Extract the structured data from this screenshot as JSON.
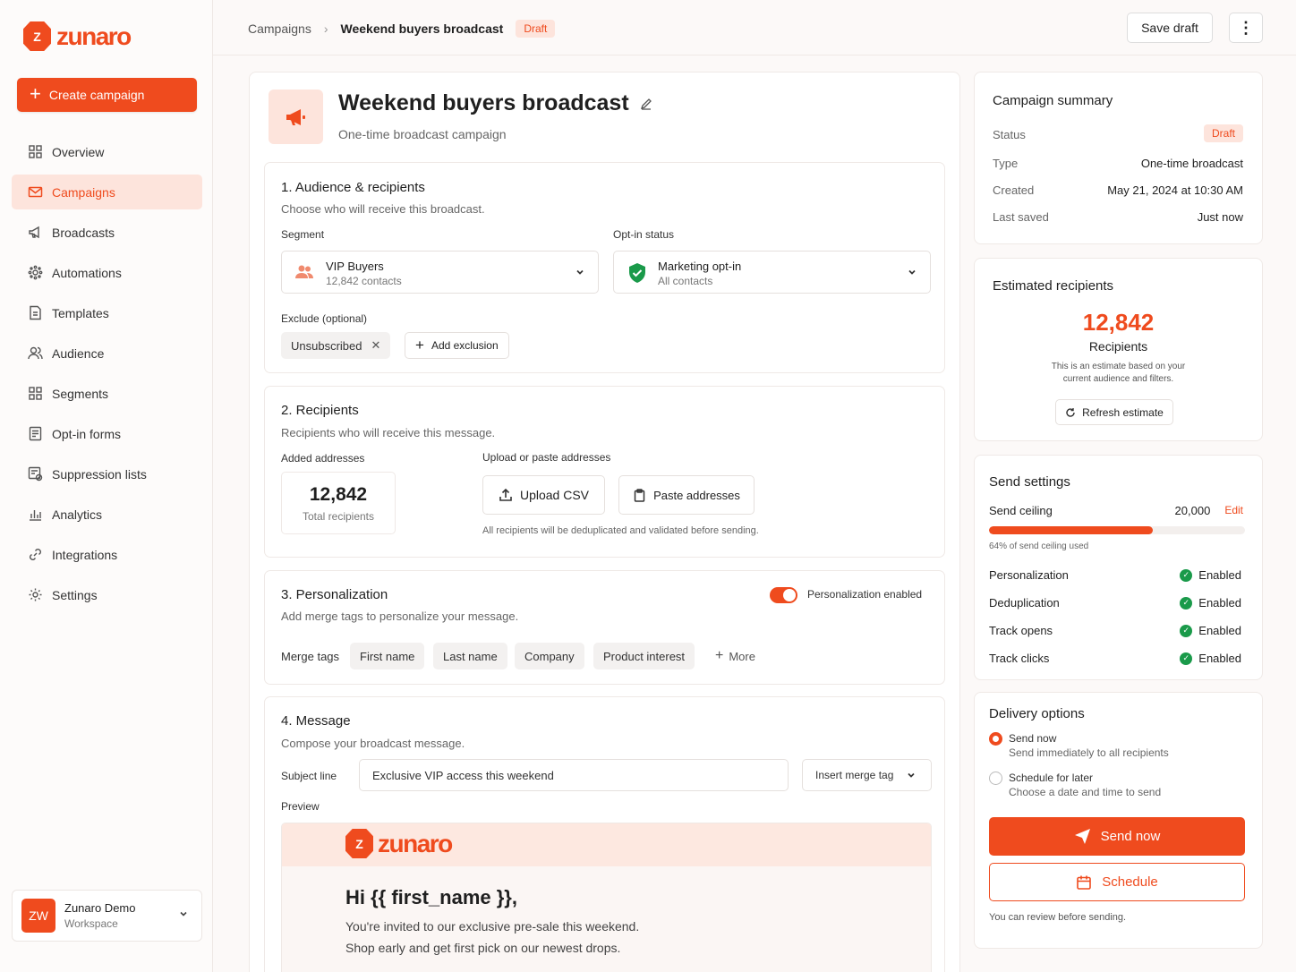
{
  "brand": {
    "name": "zunaro",
    "mark": "Z",
    "accent": "#ef4b1e"
  },
  "sidebar": {
    "create_label": "Create campaign",
    "items": [
      {
        "label": "Overview",
        "icon": "grid-icon"
      },
      {
        "label": "Campaigns",
        "icon": "mail-icon",
        "active": true
      },
      {
        "label": "Broadcasts",
        "icon": "megaphone-icon"
      },
      {
        "label": "Automations",
        "icon": "automation-icon"
      },
      {
        "label": "Templates",
        "icon": "template-icon"
      },
      {
        "label": "Audience",
        "icon": "users-icon"
      },
      {
        "label": "Segments",
        "icon": "segments-icon"
      },
      {
        "label": "Opt-in forms",
        "icon": "form-icon"
      },
      {
        "label": "Suppression lists",
        "icon": "suppression-icon"
      },
      {
        "label": "Analytics",
        "icon": "analytics-icon"
      },
      {
        "label": "Integrations",
        "icon": "link-icon"
      },
      {
        "label": "Settings",
        "icon": "gear-icon"
      }
    ],
    "workspace": {
      "initials": "ZW",
      "name": "Zunaro Demo",
      "sub": "Workspace"
    }
  },
  "topbar": {
    "crumb_root": "Campaigns",
    "crumb_current": "Weekend buyers broadcast",
    "status_badge": "Draft",
    "save_draft": "Save draft",
    "more": "⋮"
  },
  "header": {
    "title": "Weekend buyers broadcast",
    "subtitle": "One-time broadcast campaign"
  },
  "audience": {
    "title": "1. Audience & recipients",
    "desc": "Choose who will receive this broadcast.",
    "segment_label": "Segment",
    "segment_value": "VIP Buyers",
    "segment_sub": "12,842 contacts",
    "optin_label": "Opt-in status",
    "optin_value": "Marketing opt-in",
    "optin_sub": "All contacts",
    "exclude_label": "Exclude (optional)",
    "exclude_chip": "Unsubscribed",
    "add_exclusion": "Add exclusion"
  },
  "recipients": {
    "title": "2. Recipients",
    "desc": "Recipients who will receive this message.",
    "added_label": "Added addresses",
    "total": "12,842",
    "total_label": "Total recipients",
    "upload_label": "Upload or paste addresses",
    "upload_csv": "Upload CSV",
    "paste": "Paste addresses",
    "note": "All recipients will be deduplicated and validated before sending."
  },
  "personalization": {
    "title": "3. Personalization",
    "desc": "Add merge tags to personalize your message.",
    "toggle_label": "Personalization enabled",
    "enabled": true,
    "merge_label": "Merge tags",
    "tags": [
      "First name",
      "Last name",
      "Company",
      "Product interest"
    ],
    "more": "More"
  },
  "message": {
    "title": "4. Message",
    "desc": "Compose your broadcast message.",
    "subject_label": "Subject line",
    "subject_value": "Exclusive VIP access this weekend",
    "insert_tag": "Insert merge tag",
    "preview_label": "Preview",
    "preview_greeting": "Hi {{ first_name }},",
    "preview_line1": "You're invited to our exclusive pre-sale this weekend.",
    "preview_line2": "Shop early and get first pick on our newest drops."
  },
  "summary": {
    "title": "Campaign summary",
    "status_label": "Status",
    "status_value": "Draft",
    "type_label": "Type",
    "type_value": "One-time broadcast",
    "created_label": "Created",
    "created_value": "May 21, 2024 at 10:30 AM",
    "saved_label": "Last saved",
    "saved_value": "Just now"
  },
  "estimate": {
    "title": "Estimated recipients",
    "count": "12,842",
    "unit": "Recipients",
    "note1": "This is an estimate based on your",
    "note2": "current audience and filters.",
    "refresh": "Refresh estimate"
  },
  "send_settings": {
    "title": "Send settings",
    "ceiling_label": "Send ceiling",
    "ceiling_value": "20,000",
    "edit": "Edit",
    "used_percent": 64,
    "used_text": "64% of send ceiling used",
    "rows": [
      {
        "label": "Personalization",
        "value": "Enabled"
      },
      {
        "label": "Deduplication",
        "value": "Enabled"
      },
      {
        "label": "Track opens",
        "value": "Enabled"
      },
      {
        "label": "Track clicks",
        "value": "Enabled"
      }
    ]
  },
  "delivery": {
    "title": "Delivery options",
    "opt1": "Send now",
    "opt1_sub": "Send immediately to all recipients",
    "opt2": "Schedule for later",
    "opt2_sub": "Choose a date and time to send",
    "send_now": "Send now",
    "schedule": "Schedule",
    "note": "You can review before sending."
  }
}
